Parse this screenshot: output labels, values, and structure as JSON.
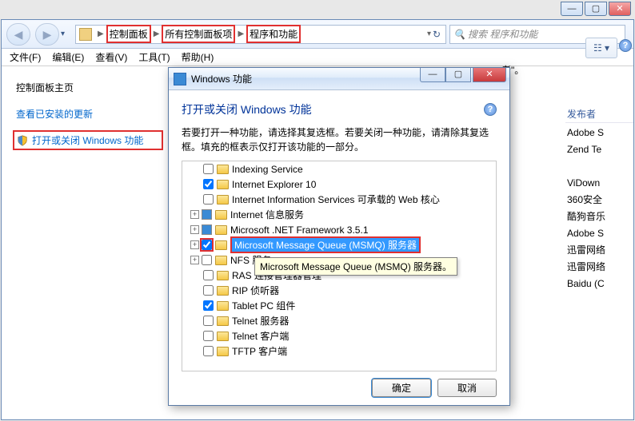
{
  "titlebar": {
    "minimize": "—",
    "maximize": "▢",
    "close": "✕"
  },
  "address": {
    "crumb1": "控制面板",
    "crumb2": "所有控制面板项",
    "crumb3": "程序和功能",
    "sep": "▶"
  },
  "search": {
    "placeholder": "搜索 程序和功能"
  },
  "menu": {
    "file": "文件(F)",
    "edit": "编辑(E)",
    "view": "查看(V)",
    "tools": "工具(T)",
    "help": "帮助(H)"
  },
  "leftpane": {
    "title": "控制面板主页",
    "link1": "查看已安装的更新",
    "link2": "打开或关闭 Windows 功能"
  },
  "right": {
    "trailing_quote": "者\"。",
    "view_btn": "☷ ▾",
    "header": "发布者",
    "items": [
      "Adobe S",
      "Zend Te",
      "",
      "ViDown",
      "360安全",
      "酷狗音乐",
      "Adobe S",
      "迅雷网络",
      "迅雷网络",
      "Baidu (C"
    ]
  },
  "dialog": {
    "title": "Windows 功能",
    "heading": "打开或关闭 Windows 功能",
    "desc": "若要打开一种功能，请选择其复选框。若要关闭一种功能，请清除其复选框。填充的框表示仅打开该功能的一部分。",
    "ok": "确定",
    "cancel": "取消",
    "tooltip": "Microsoft Message Queue (MSMQ) 服务器。",
    "items": [
      {
        "exp": "",
        "check": "unchecked",
        "label": "Indexing Service"
      },
      {
        "exp": "",
        "check": "checked",
        "label": "Internet Explorer 10"
      },
      {
        "exp": "",
        "check": "unchecked",
        "label": "Internet Information Services 可承载的 Web 核心"
      },
      {
        "exp": "+",
        "check": "fill",
        "label": "Internet 信息服务"
      },
      {
        "exp": "+",
        "check": "fill",
        "label": "Microsoft .NET Framework 3.5.1"
      },
      {
        "exp": "+",
        "check": "checked",
        "label": "Microsoft Message Queue (MSMQ) 服务器",
        "selected": true
      },
      {
        "exp": "+",
        "check": "unchecked",
        "label": "NFS 服务"
      },
      {
        "exp": "",
        "check": "unchecked",
        "label": "RAS 连接管理器管理"
      },
      {
        "exp": "",
        "check": "unchecked",
        "label": "RIP 侦听器"
      },
      {
        "exp": "",
        "check": "checked",
        "label": "Tablet PC 组件"
      },
      {
        "exp": "",
        "check": "unchecked",
        "label": "Telnet 服务器"
      },
      {
        "exp": "",
        "check": "unchecked",
        "label": "Telnet 客户端"
      },
      {
        "exp": "",
        "check": "unchecked",
        "label": "TFTP 客户端"
      }
    ]
  }
}
